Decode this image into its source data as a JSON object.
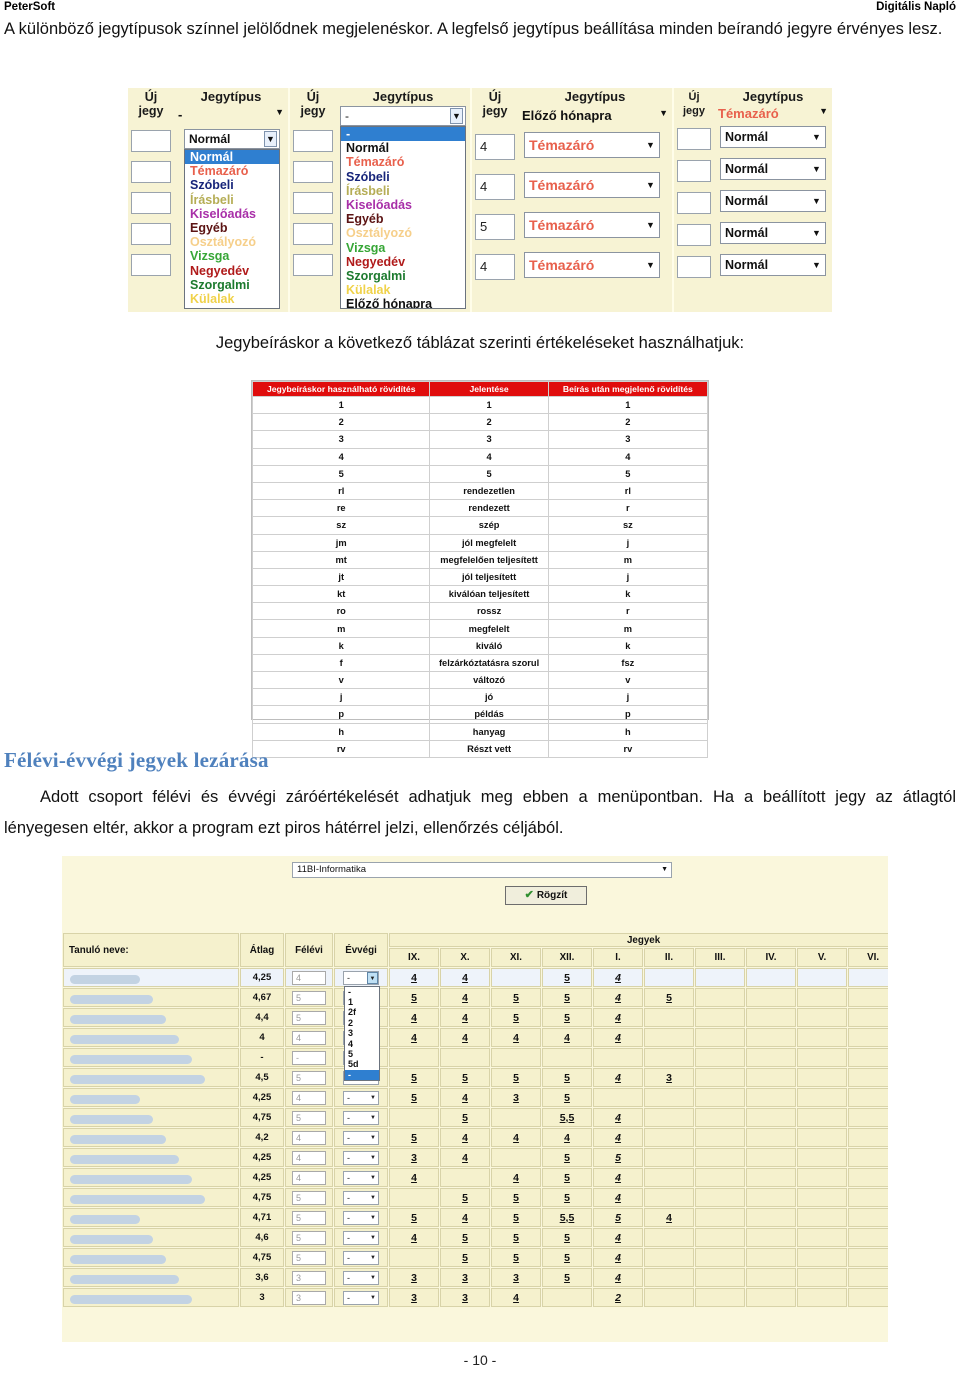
{
  "runninghead": {
    "left": "PeterSoft",
    "right": "Digitális Napló"
  },
  "intro_paragraph": "A különböző jegytípusok színnel jelölődnek megjelenéskor. A legfelső jegytípus beállítása minden beírandó jegyre érvényes lesz.",
  "caption": "Jegybeíráskor a következő táblázat szerinti értékeléseket használhatjuk:",
  "section": {
    "heading": "Félévi-évvégi jegyek lezárása",
    "paragraph": "Adott csoport félévi és évvégi záróértékelését adhatjuk meg ebben a menüpontban. Ha a beállított jegy az átlagtól lényegesen eltér, akkor a program ezt piros hátérrel jelzi, ellenőrzés céljából."
  },
  "footer": "- 10 -",
  "figure1": {
    "col_new_label_line1": "Új",
    "col_new_label_line2": "jegy",
    "col_type_label": "Jegytípus",
    "grade_type_options": [
      {
        "label": "Normál",
        "color": "#111111"
      },
      {
        "label": "Témazáró",
        "color": "#e8604c"
      },
      {
        "label": "Szóbeli",
        "color": "#16247a"
      },
      {
        "label": "Írásbeli",
        "color": "#b5ad55"
      },
      {
        "label": "Kiselőadás",
        "color": "#a82fa8"
      },
      {
        "label": "Egyéb",
        "color": "#5c1414"
      },
      {
        "label": "Osztályozó",
        "color": "#f6cf8a"
      },
      {
        "label": "Vizsga",
        "color": "#36a636"
      },
      {
        "label": "Negyedév",
        "color": "#b01a1a"
      },
      {
        "label": "Szorgalmi",
        "color": "#1c7a2e"
      },
      {
        "label": "Külalak",
        "color": "#f0d24a"
      },
      {
        "label": "Előző hónapra",
        "color": "#111111"
      }
    ],
    "panels": [
      {
        "name": "panel-1",
        "header_value": "-",
        "row_select_value": "Normál",
        "row_select_color": "#111111",
        "new_grades": [
          "",
          "",
          "",
          "",
          ""
        ],
        "dropdown_open": true,
        "highlight_index": 0,
        "option_count": 11
      },
      {
        "name": "panel-2",
        "header_value": "-",
        "new_grades": [
          "",
          "",
          "",
          "",
          ""
        ],
        "dropdown_open": true,
        "highlight_label": "-",
        "option_count": 12
      },
      {
        "name": "panel-3",
        "header_value": "Előző hónapra",
        "header_color": "#111111",
        "new_grades": [
          "4",
          "4",
          "5",
          "4"
        ],
        "row_values": [
          "Témazáró",
          "Témazáró",
          "Témazáró",
          "Témazáró"
        ],
        "row_color": "#e8604c"
      },
      {
        "name": "panel-4",
        "header_value": "Témazáró",
        "header_color": "#e8604c",
        "new_grades": [
          "",
          "",
          "",
          "",
          ""
        ],
        "row_values": [
          "Normál",
          "Normál",
          "Normál",
          "Normál",
          "Normál"
        ],
        "row_color": "#111111"
      }
    ]
  },
  "figure2": {
    "headers": [
      "Jegybeíráskor használható rövidítés",
      "Jelentése",
      "Beírás után megjelenő rövidítés"
    ],
    "rows": [
      [
        "1",
        "1",
        "1"
      ],
      [
        "2",
        "2",
        "2"
      ],
      [
        "3",
        "3",
        "3"
      ],
      [
        "4",
        "4",
        "4"
      ],
      [
        "5",
        "5",
        "5"
      ],
      [
        "rl",
        "rendezetlen",
        "rl"
      ],
      [
        "re",
        "rendezett",
        "r"
      ],
      [
        "sz",
        "szép",
        "sz"
      ],
      [
        "jm",
        "jól megfelelt",
        "j"
      ],
      [
        "mt",
        "megfelelően teljesített",
        "m"
      ],
      [
        "jt",
        "jól teljesített",
        "j"
      ],
      [
        "kt",
        "kiválóan teljesített",
        "k"
      ],
      [
        "ro",
        "rossz",
        "r"
      ],
      [
        "m",
        "megfelelt",
        "m"
      ],
      [
        "k",
        "kiváló",
        "k"
      ],
      [
        "f",
        "felzárkóztatásra szorul",
        "fsz"
      ],
      [
        "v",
        "változó",
        "v"
      ],
      [
        "j",
        "jó",
        "j"
      ],
      [
        "p",
        "példás",
        "p"
      ],
      [
        "h",
        "hanyag",
        "h"
      ],
      [
        "rv",
        "Részt vett",
        "rv"
      ]
    ]
  },
  "figure3": {
    "group_select_value": "11BI-Informatika",
    "save_button_label": "Rögzít",
    "headers": {
      "student": "Tanuló neve:",
      "average": "Átlag",
      "semester": "Félévi",
      "yearend": "Évvégi",
      "grades_group": "Jegyek",
      "months": [
        "IX.",
        "X.",
        "XI.",
        "XII.",
        "I.",
        "II.",
        "III.",
        "IV.",
        "V.",
        "VI."
      ]
    },
    "yearend_options": [
      "-",
      "1",
      "2f",
      "2",
      "3",
      "4",
      "5",
      "5d"
    ],
    "yearend_highlight": "-",
    "rows": [
      {
        "avg": "4,25",
        "felevi": "4",
        "evvegi": "-",
        "grades": [
          "4",
          "4",
          "",
          "5",
          "4",
          "",
          "",
          "",
          "",
          ""
        ],
        "open": true
      },
      {
        "avg": "4,67",
        "felevi": "5",
        "evvegi": "-",
        "grades": [
          "5",
          "4",
          "5",
          "5",
          "4",
          "5",
          "",
          "",
          "",
          ""
        ]
      },
      {
        "avg": "4,4",
        "felevi": "5",
        "evvegi": "-",
        "grades": [
          "4",
          "4",
          "5",
          "5",
          "4",
          "",
          "",
          "",
          "",
          ""
        ]
      },
      {
        "avg": "4",
        "felevi": "4",
        "evvegi": "-",
        "grades": [
          "4",
          "4",
          "4",
          "4",
          "4",
          "",
          "",
          "",
          "",
          ""
        ]
      },
      {
        "avg": "-",
        "felevi": "-",
        "evvegi": "-",
        "grades": [
          "",
          "",
          "",
          "",
          "",
          "",
          "",
          "",
          "",
          ""
        ]
      },
      {
        "avg": "4,5",
        "felevi": "5",
        "evvegi": "-",
        "grades": [
          "5",
          "5",
          "5",
          "5",
          "4",
          "3",
          "",
          "",
          "",
          ""
        ]
      },
      {
        "avg": "4,25",
        "felevi": "4",
        "evvegi": "-",
        "grades": [
          "5",
          "4",
          "3",
          "5",
          "",
          "",
          "",
          "",
          "",
          ""
        ]
      },
      {
        "avg": "4,75",
        "felevi": "5",
        "evvegi": "-",
        "grades": [
          "",
          "5",
          "",
          "5,5",
          "4",
          "",
          "",
          "",
          "",
          ""
        ]
      },
      {
        "avg": "4,2",
        "felevi": "4",
        "evvegi": "-",
        "grades": [
          "5",
          "4",
          "4",
          "4",
          "4",
          "",
          "",
          "",
          "",
          ""
        ]
      },
      {
        "avg": "4,25",
        "felevi": "4",
        "evvegi": "-",
        "grades": [
          "3",
          "4",
          "",
          "5",
          "5",
          "",
          "",
          "",
          "",
          ""
        ]
      },
      {
        "avg": "4,25",
        "felevi": "4",
        "evvegi": "-",
        "grades": [
          "4",
          "",
          "4",
          "5",
          "4",
          "",
          "",
          "",
          "",
          ""
        ]
      },
      {
        "avg": "4,75",
        "felevi": "5",
        "evvegi": "-",
        "grades": [
          "",
          "5",
          "5",
          "5",
          "4",
          "",
          "",
          "",
          "",
          ""
        ]
      },
      {
        "avg": "4,71",
        "felevi": "5",
        "evvegi": "-",
        "grades": [
          "5",
          "4",
          "5",
          "5,5",
          "5",
          "4",
          "",
          "",
          "",
          ""
        ]
      },
      {
        "avg": "4,6",
        "felevi": "5",
        "evvegi": "-",
        "grades": [
          "4",
          "5",
          "5",
          "5",
          "4",
          "",
          "",
          "",
          "",
          ""
        ]
      },
      {
        "avg": "4,75",
        "felevi": "5",
        "evvegi": "-",
        "grades": [
          "",
          "5",
          "5",
          "5",
          "4",
          "",
          "",
          "",
          "",
          ""
        ]
      },
      {
        "avg": "3,6",
        "felevi": "3",
        "evvegi": "-",
        "grades": [
          "3",
          "3",
          "3",
          "5",
          "4",
          "",
          "",
          "",
          "",
          ""
        ]
      },
      {
        "avg": "3",
        "felevi": "3",
        "evvegi": "-",
        "grades": [
          "3",
          "3",
          "4",
          "",
          "2",
          "",
          "",
          "",
          "",
          ""
        ]
      }
    ]
  }
}
